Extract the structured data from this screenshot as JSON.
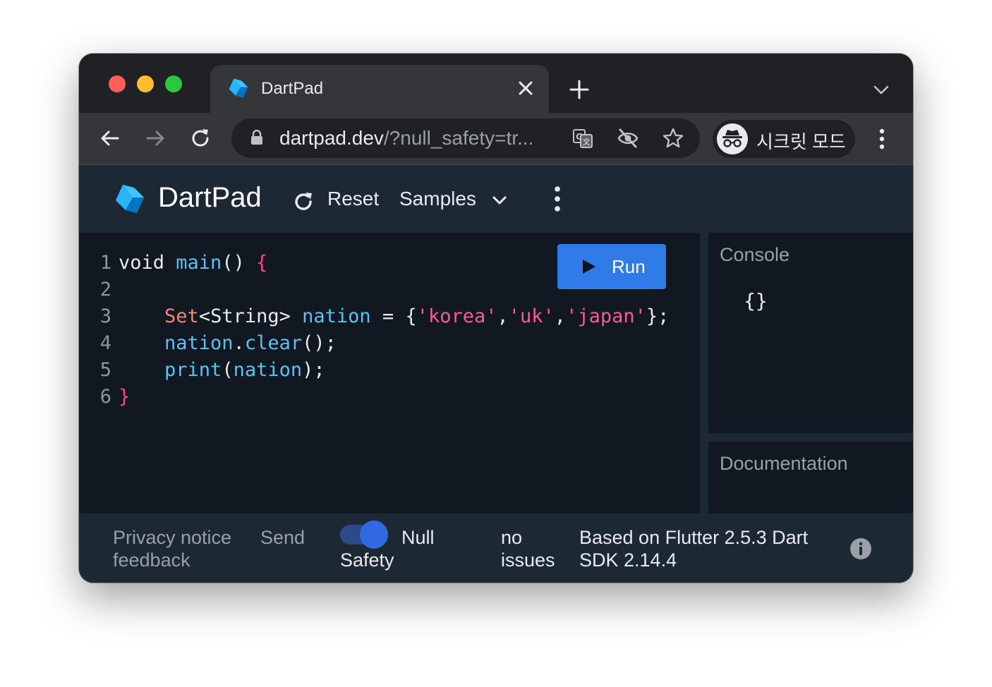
{
  "browser": {
    "tab_title": "DartPad",
    "url_host": "dartpad.dev",
    "url_path": "/?null_safety=tr...",
    "profile_label": "시크릿 모드",
    "icons": {
      "back": "arrow-left-icon",
      "forward": "arrow-right-icon",
      "reload": "reload-icon",
      "lock": "lock-icon",
      "translate": "translate-icon",
      "tracking": "eye-slash-icon",
      "bookmark": "star-icon",
      "incognito": "incognito-icon",
      "menu": "kebab-menu-icon"
    }
  },
  "app": {
    "brand": "DartPad",
    "reset_label": "Reset",
    "samples_label": "Samples",
    "run_label": "Run",
    "accent_color": "#2f7be8"
  },
  "editor": {
    "line_numbers": [
      "1",
      "2",
      "3",
      "4",
      "5",
      "6"
    ],
    "code": [
      "void main() {",
      "",
      "    Set<String> nation = {'korea','uk','japan'};",
      "    nation.clear();",
      "    print(nation);",
      "}"
    ],
    "tokens": {
      "kw_void": "void ",
      "fn_main": "main",
      "parens_main": "() ",
      "brace_open": "{",
      "indent": "    ",
      "type_set": "Set",
      "type_generic": "<String> ",
      "var_nation": "nation",
      "assign": " = {",
      "str_korea": "'korea'",
      "comma": ",",
      "str_uk": "'uk'",
      "str_japan": "'japan'",
      "set_close": "};",
      "dot": ".",
      "fn_clear": "clear",
      "call_end": "();",
      "fn_print": "print",
      "paren_open": "(",
      "paren_close_semi": ");",
      "brace_close": "}"
    }
  },
  "console": {
    "title": "Console",
    "output": "{}"
  },
  "documentation": {
    "title": "Documentation"
  },
  "status": {
    "privacy": "Privacy notice",
    "send_feedback_1": "Send",
    "send_feedback_2": "feedback",
    "null_safety_1": "Null",
    "null_safety_2": "Safety",
    "null_safety_enabled": true,
    "issues_1": "no",
    "issues_2": "issues",
    "version_1": "Based on Flutter 2.5.3 Dart",
    "version_2": "SDK 2.14.4"
  }
}
